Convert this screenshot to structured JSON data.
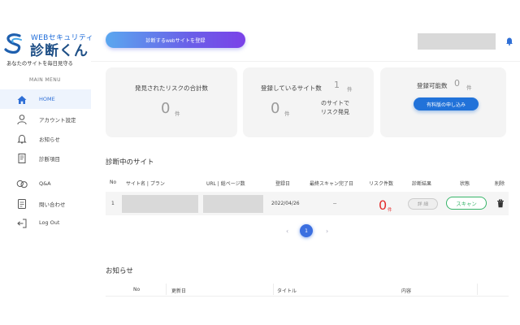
{
  "brand": {
    "logo_sub": "WEBセキュリティ",
    "logo_main": "診断くん",
    "tagline": "あなたのサイトを毎日見守る"
  },
  "sidebar": {
    "menu_title": "MAIN MENU",
    "items": [
      {
        "label": "HOME",
        "icon": "home-icon",
        "active": true
      },
      {
        "label": "アカウント設定",
        "icon": "user-icon",
        "active": false
      },
      {
        "label": "お知らせ",
        "icon": "bell-icon",
        "active": false
      },
      {
        "label": "診断項目",
        "icon": "document-icon",
        "active": false
      },
      {
        "label": "Q&A",
        "icon": "chat-icon",
        "active": false
      },
      {
        "label": "問い合わせ",
        "icon": "contact-icon",
        "active": false
      },
      {
        "label": "Log Out",
        "icon": "logout-icon",
        "active": false
      }
    ]
  },
  "header": {
    "register_label": "診断するwebサイトを登録"
  },
  "cards": {
    "risk": {
      "title": "発見されたリスクの合計数",
      "value": "0",
      "unit": "件"
    },
    "sites": {
      "title": "登録しているサイト数",
      "title_value": "1",
      "title_unit": "件",
      "value": "0",
      "unit": "件",
      "note_line1": "のサイトで",
      "note_line2": "リスク発見"
    },
    "capacity": {
      "title": "登録可能数",
      "value": "0",
      "unit": "件",
      "button_label": "有料版の申し込み"
    }
  },
  "sites_section": {
    "title": "診断中のサイト",
    "columns": [
      "No",
      "サイト名 | プラン",
      "URL | 総ページ数",
      "登録日",
      "最終スキャン完了日",
      "リスク件数",
      "診断結果",
      "状態",
      "削除"
    ],
    "rows": [
      {
        "no": "1",
        "registered": "2022/04/26",
        "last_scan": "--",
        "risk_count": "0",
        "risk_unit": "件",
        "detail_label": "詳 細",
        "status_label": "スキャン"
      }
    ],
    "pagination": {
      "prev": "‹",
      "current": "1",
      "next": "›"
    }
  },
  "news_section": {
    "title": "お知らせ",
    "columns": [
      "No",
      "更新日",
      "タイトル",
      "内容"
    ]
  },
  "colors": {
    "accent": "#2f6fd6",
    "risk": "#e32c2c",
    "scan": "#38b56a"
  }
}
